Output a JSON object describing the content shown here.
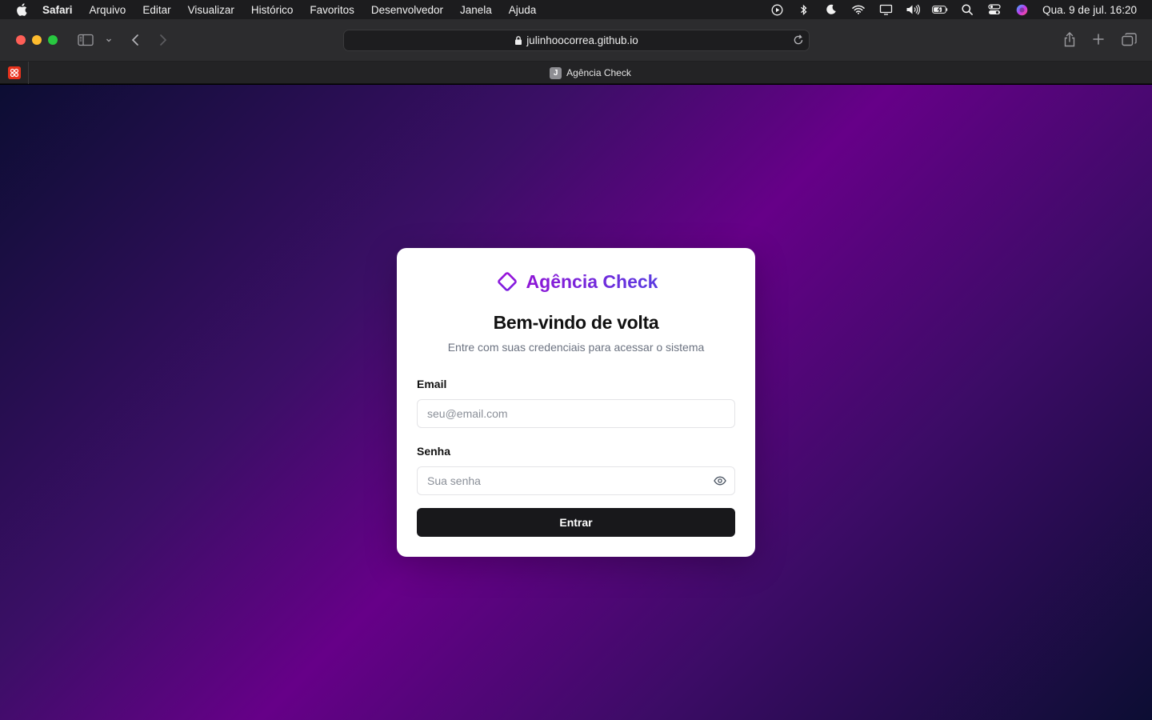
{
  "menubar": {
    "items": [
      "Safari",
      "Arquivo",
      "Editar",
      "Visualizar",
      "Histórico",
      "Favoritos",
      "Desenvolvedor",
      "Janela",
      "Ajuda"
    ],
    "clock": "Qua. 9 de jul.  16:20",
    "status_icons": [
      "play-circle-icon",
      "bluetooth-icon",
      "moon-icon",
      "wifi-icon",
      "display-icon",
      "volume-icon",
      "battery-icon",
      "search-icon",
      "control-center-icon",
      "siri-icon"
    ]
  },
  "browser": {
    "url": "julinhoocorrea.github.io",
    "tab_title": "Agência Check",
    "tab_favicon_letter": "J"
  },
  "login": {
    "brand_name": "Agência Check",
    "title": "Bem-vindo de volta",
    "subtitle": "Entre com suas credenciais para acessar o sistema",
    "email_label": "Email",
    "email_placeholder": "seu@email.com",
    "email_value": "",
    "password_label": "Senha",
    "password_placeholder": "Sua senha",
    "password_value": "",
    "submit_label": "Entrar"
  },
  "colors": {
    "brand_purple": "#8e15d6",
    "brand_indigo": "#5a3be0",
    "button_dark": "#18181b",
    "page_gradient_center": "#660088",
    "page_gradient_edge": "#0c0d33"
  }
}
